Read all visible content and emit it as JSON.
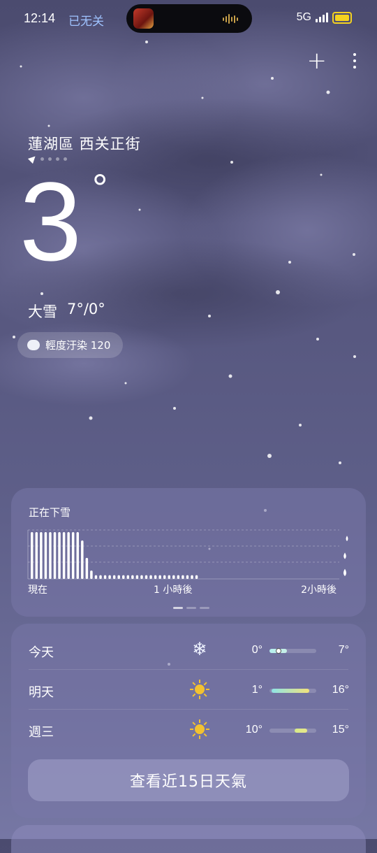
{
  "status": {
    "time": "12:14",
    "extra": "已无关",
    "network": "5G",
    "battery_color": "#f4d21f"
  },
  "header": {
    "add_icon": "plus-icon",
    "menu_icon": "more-vertical-icon"
  },
  "location": {
    "name": "蓮湖區 西关正街"
  },
  "current": {
    "temperature": "3",
    "degree": "°",
    "condition": "大雪",
    "range": "7°/0°",
    "aqi_label": "輕度汙染 120"
  },
  "precip_card": {
    "title": "正在下雪",
    "x_labels": [
      "現在",
      "1 小時後",
      "2小時後"
    ],
    "chart_data": {
      "type": "bar",
      "title": "正在下雪",
      "x": [
        "現在",
        "1 小時後",
        "2小時後"
      ],
      "values": [
        1,
        1,
        1,
        1,
        1,
        1,
        1,
        1,
        1,
        1,
        1,
        0.82,
        0.45,
        0.18,
        0.08,
        0.08,
        0.08,
        0.08,
        0.08,
        0.08,
        0.08,
        0.08,
        0.08,
        0.08,
        0.08,
        0.08,
        0.08,
        0.08,
        0.08,
        0.08,
        0.08,
        0.08,
        0.08,
        0.08,
        0.08,
        0.08,
        0.08
      ],
      "ylim": [
        0,
        1
      ],
      "grid": true
    }
  },
  "forecast": {
    "days": [
      {
        "day": "今天",
        "icon": "snowflake-icon",
        "min": "0°",
        "max": "7°",
        "bar_start": 0.0,
        "bar_end": 0.38,
        "colors": [
          "#b6f0ef",
          "#c7efe6"
        ],
        "current": true
      },
      {
        "day": "明天",
        "icon": "sun-icon",
        "min": "1°",
        "max": "16°",
        "bar_start": 0.05,
        "bar_end": 0.85,
        "colors": [
          "#8ee4e6",
          "#f2e27a"
        ],
        "current": false
      },
      {
        "day": "週三",
        "icon": "sun-icon",
        "min": "10°",
        "max": "15°",
        "bar_start": 0.53,
        "bar_end": 0.8,
        "colors": [
          "#d6ea8a",
          "#e8e78a"
        ],
        "current": false
      }
    ],
    "button_label": "查看近15日天氣"
  }
}
